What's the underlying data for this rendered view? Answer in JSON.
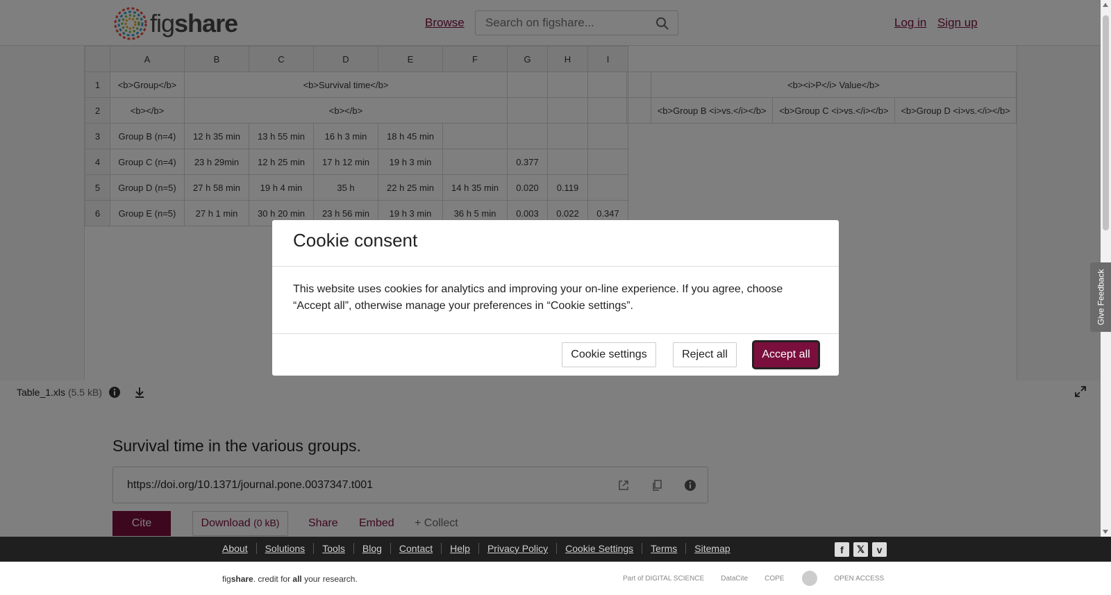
{
  "header": {
    "logo_text_light": "fig",
    "logo_text_bold": "share",
    "browse_label": "Browse",
    "search_placeholder": "Search on figshare...",
    "login_label": "Log in",
    "signup_label": "Sign up"
  },
  "sheet": {
    "column_headers": [
      "",
      "A",
      "B",
      "C",
      "D",
      "E",
      "F",
      "G",
      "H",
      "I"
    ],
    "rows": [
      {
        "num": "1",
        "a": "<b>Group</b>",
        "merged": "<b>Survival time</b>",
        "pval_header": "<b><i>P</i> Value</b>"
      },
      {
        "num": "2",
        "a": "<b></b>",
        "merged": "<b></b>",
        "pval_cols": [
          "<b>Group B <i>vs.</i></b>",
          "<b>Group C <i>vs.</i></b>",
          "<b>Group D <i>vs.</i></b>"
        ]
      },
      {
        "num": "3",
        "cells": [
          "Group B (n=4)",
          "12 h 35 min",
          "13 h 55 min",
          "16 h 3 min",
          "18 h 45 min",
          "",
          "",
          "",
          ""
        ]
      },
      {
        "num": "4",
        "cells": [
          "Group C (n=4)",
          "23 h 29min",
          "12 h 25 min",
          "17 h 12 min",
          "19 h 3 min",
          "",
          "0.377",
          "",
          ""
        ]
      },
      {
        "num": "5",
        "cells": [
          "Group D (n=5)",
          "27 h 58 min",
          "19 h 4 min",
          "35 h",
          "22 h 25 min",
          "14 h 35 min",
          "0.020",
          "0.119",
          ""
        ]
      },
      {
        "num": "6",
        "cells": [
          "Group E (n=5)",
          "27 h 1 min",
          "30 h 20 min",
          "23 h 56 min",
          "19 h 3 min",
          "36 h 5 min",
          "0.003",
          "0.022",
          "0.347"
        ]
      }
    ]
  },
  "file": {
    "name": "Table_1.xls",
    "size": "(5.5 kB)"
  },
  "item": {
    "title": "Survival time in the various groups.",
    "doi": "https://doi.org/10.1371/journal.pone.0037347.t001",
    "cite_label": "Cite",
    "download_label": "Download",
    "download_size": "(0 kB)",
    "share_label": "Share",
    "embed_label": "Embed",
    "collect_label": "+ Collect"
  },
  "footer": {
    "links": [
      "About",
      "Solutions",
      "Tools",
      "Blog",
      "Contact",
      "Help",
      "Privacy Policy",
      "Cookie Settings",
      "Terms",
      "Sitemap"
    ],
    "tagline_fig": "fig",
    "tagline_share": "share",
    "tagline_mid": ". credit for ",
    "tagline_all": "all",
    "tagline_end": " your research.",
    "partners": [
      "Part of DIGITAL SCIENCE",
      "DataCite",
      "COPE",
      "",
      "OPEN ACCESS"
    ]
  },
  "modal": {
    "title": "Cookie consent",
    "body": "This website uses cookies for analytics and improving your on-line experience. If you agree, choose “Accept all”, otherwise manage your preferences in “Cookie settings”.",
    "settings_label": "Cookie settings",
    "reject_label": "Reject all",
    "accept_label": "Accept all"
  },
  "feedback_label": "Give Feedback",
  "colors": {
    "brand": "#7a0f3d",
    "footer_bg": "#1f1f1f"
  }
}
